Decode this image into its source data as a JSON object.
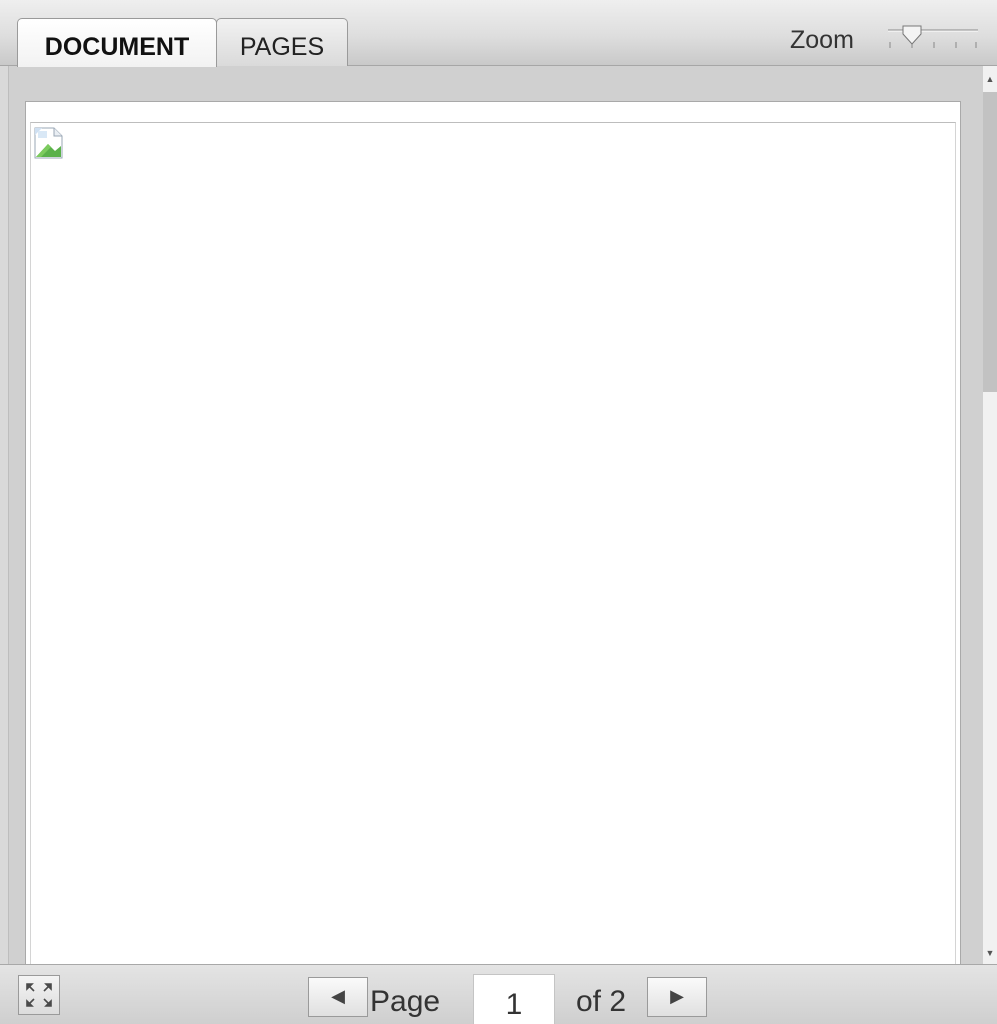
{
  "tabs": [
    {
      "label": "DOCUMENT",
      "active": true
    },
    {
      "label": "PAGES",
      "active": false
    }
  ],
  "zoom": {
    "label": "Zoom",
    "level": 0.25,
    "icon": "zoom-slider"
  },
  "document": {
    "image_icon": "broken-image-icon"
  },
  "scrollbar": {
    "position": 0
  },
  "footer": {
    "fullscreen_icon": "fullscreen-icon",
    "prev_icon": "triangle-left",
    "next_icon": "triangle-right",
    "page_label": "Page",
    "current_page": "1",
    "of_label": "of 2"
  },
  "colors": {
    "toolbar": "#dedede",
    "page_background": "#ffffff",
    "scroll_thumb": "#c2c2c2"
  }
}
